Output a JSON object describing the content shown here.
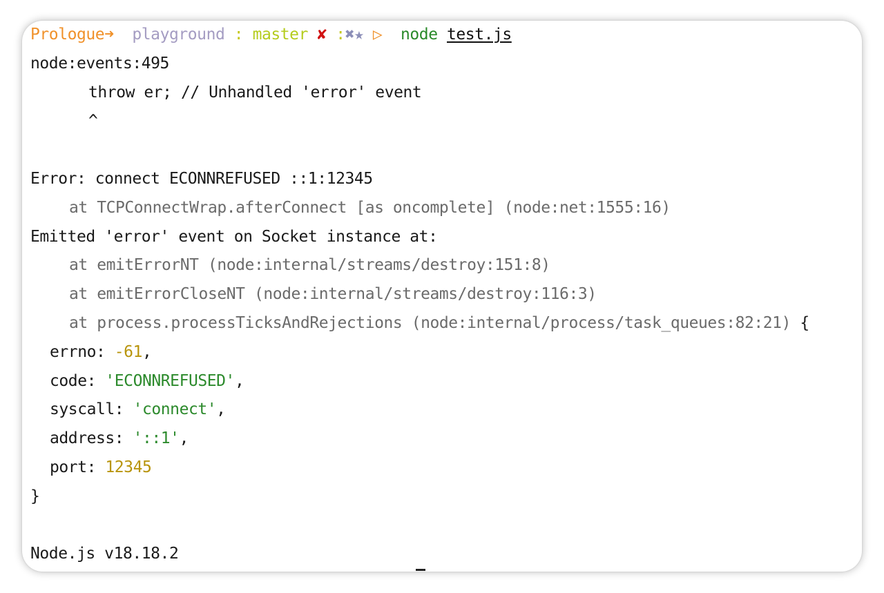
{
  "prompt": {
    "host": "Prologue",
    "arrow": "➜",
    "dir": "playground",
    "sep": ":",
    "branch": "master",
    "dirty": "✘",
    "status_sep": ":",
    "status_icons": "✖★",
    "play": "▷",
    "command": "node",
    "argument": "test.js"
  },
  "output": {
    "l1": "node:events:495",
    "l2": "throw er; // Unhandled 'error' event",
    "l3": "^",
    "error": "Error: connect ECONNREFUSED ::1:12345",
    "trace1": "at TCPConnectWrap.afterConnect [as oncomplete] (node:net:1555:16)",
    "emitted": "Emitted 'error' event on Socket instance at:",
    "trace2": "at emitErrorNT (node:internal/streams/destroy:151:8)",
    "trace3": "at emitErrorCloseNT (node:internal/streams/destroy:116:3)",
    "trace4": "at process.processTicksAndRejections (node:internal/process/task_queues:82:21)",
    "open_brace": "{",
    "errno_key": "errno: ",
    "errno_val": "-61",
    "code_key": "code: ",
    "code_val": "'ECONNREFUSED'",
    "syscall_key": "syscall: ",
    "syscall_val": "'connect'",
    "address_key": "address: ",
    "address_val": "'::1'",
    "port_key": "port: ",
    "port_val": "12345",
    "comma": ",",
    "close_brace": "}",
    "version": "Node.js v18.18.2"
  }
}
